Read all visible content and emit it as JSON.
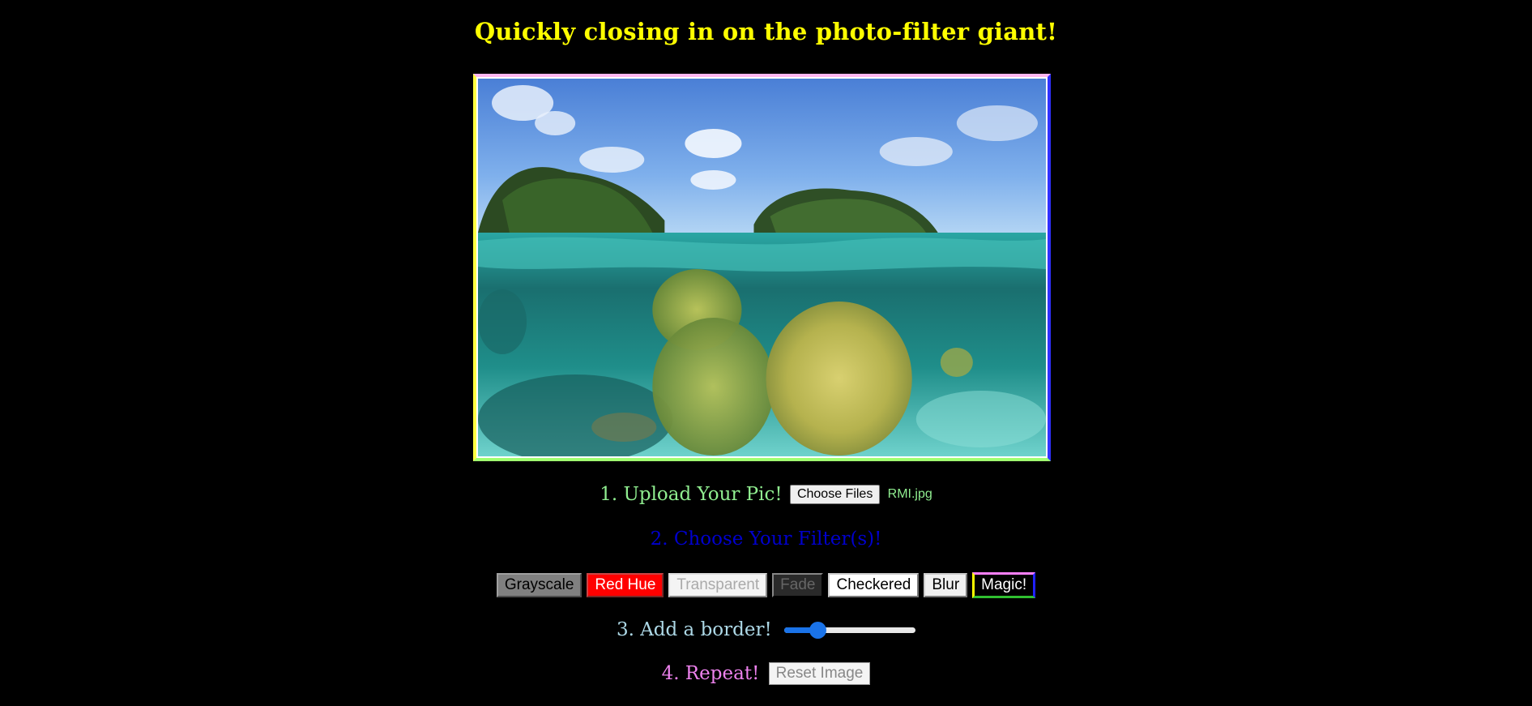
{
  "header": {
    "title": "Quickly closing in on the photo-filter giant!"
  },
  "image": {
    "description_icon": "underwater-coral-photo"
  },
  "upload": {
    "label": "1. Upload Your Pic!",
    "button_label": "Choose Files",
    "file_name": "RMI.jpg"
  },
  "filters": {
    "label": "2. Choose Your Filter(s)!",
    "buttons": [
      {
        "label": "Grayscale"
      },
      {
        "label": "Red Hue"
      },
      {
        "label": "Transparent"
      },
      {
        "label": "Fade"
      },
      {
        "label": "Checkered"
      },
      {
        "label": "Blur"
      },
      {
        "label": "Magic!"
      }
    ]
  },
  "border": {
    "label": "3. Add a border!",
    "slider_value": 0.25
  },
  "repeat": {
    "label": "4. Repeat!",
    "button_label": "Reset Image"
  },
  "colors": {
    "title": "#ffff00",
    "step1": "#90ee90",
    "step2": "#0000cd",
    "step3": "#add8e6",
    "step4": "#ee82ee",
    "slider_accent": "#1a73e8"
  }
}
